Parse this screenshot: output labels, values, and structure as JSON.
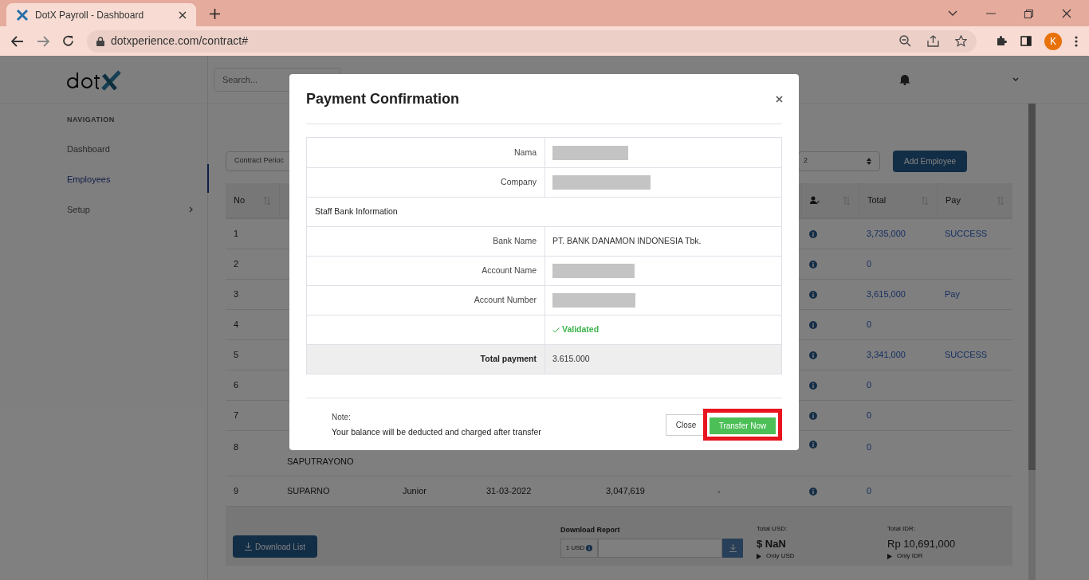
{
  "browser": {
    "tab_title": "DotX Payroll - Dashboard",
    "url": "dotxperience.com/contract#",
    "profile_initial": "K"
  },
  "header": {
    "search_placeholder": "Search..."
  },
  "sidebar": {
    "heading": "NAVIGATION",
    "items": [
      {
        "label": "Dashboard",
        "selected": false,
        "has_children": false
      },
      {
        "label": "Employees",
        "selected": true,
        "has_children": false
      },
      {
        "label": "Setup",
        "selected": false,
        "has_children": true
      }
    ]
  },
  "filters": {
    "period_select": "Contract Perioc",
    "year_select": "2",
    "add_button": "Add Employee"
  },
  "table": {
    "columns": [
      {
        "kind": "text",
        "label": "No"
      },
      {
        "kind": "hidden"
      },
      {
        "kind": "hidden"
      },
      {
        "kind": "hidden"
      },
      {
        "kind": "hidden"
      },
      {
        "kind": "hidden"
      },
      {
        "kind": "icon"
      },
      {
        "kind": "text",
        "label": "Total"
      },
      {
        "kind": "text",
        "label": "Pay"
      }
    ],
    "rows": [
      {
        "no": "1",
        "total": "3,735,000",
        "pay": "SUCCESS"
      },
      {
        "no": "2",
        "total": "0"
      },
      {
        "no": "3",
        "total": "3,615,000",
        "pay": "Pay"
      },
      {
        "no": "4",
        "total": "0"
      },
      {
        "no": "5",
        "total": "3,341,000",
        "pay": "SUCCESS"
      },
      {
        "no": "6",
        "total": "0"
      },
      {
        "no": "7",
        "total": "0"
      },
      {
        "no": "8",
        "name": "SAPUTRAYONO",
        "total": "0"
      },
      {
        "no": "9",
        "name": "SUPARNO",
        "position": "Junior",
        "date": "31-03-2022",
        "salary": "3,047,619",
        "column_6": "-",
        "total": "0"
      }
    ]
  },
  "footer": {
    "download_list": "Download List",
    "report_label": "Download Report",
    "currency_addon": "1 USD",
    "total_usd_label": "Total USD:",
    "total_usd": "$ NaN",
    "only_usd": "Only USD",
    "total_idr_label": "Total IDR:",
    "total_idr": "Rp 10,691,000",
    "only_idr": "Only IDR"
  },
  "modal": {
    "title": "Payment Confirmation",
    "rows": [
      {
        "kind": "field",
        "label": "Nama",
        "redacted": true
      },
      {
        "kind": "field",
        "label": "Company",
        "redacted": true
      },
      {
        "kind": "section",
        "label": "Staff Bank Information"
      },
      {
        "kind": "field",
        "label": "Bank Name",
        "value": "PT. BANK DANAMON INDONESIA Tbk."
      },
      {
        "kind": "field",
        "label": "Account Name",
        "redacted": true
      },
      {
        "kind": "field",
        "label": "Account Number",
        "redacted": true
      },
      {
        "kind": "status",
        "value": "Validated"
      },
      {
        "kind": "total",
        "label": "Total payment",
        "value": "3.615.000"
      }
    ],
    "note_label": "Note:",
    "note": "Your balance will be deducted and charged after transfer",
    "buttons": [
      {
        "kind": "secondary",
        "label": "Close",
        "highlighted": false
      },
      {
        "kind": "primary",
        "label": "Transfer Now",
        "highlighted": true
      }
    ]
  }
}
